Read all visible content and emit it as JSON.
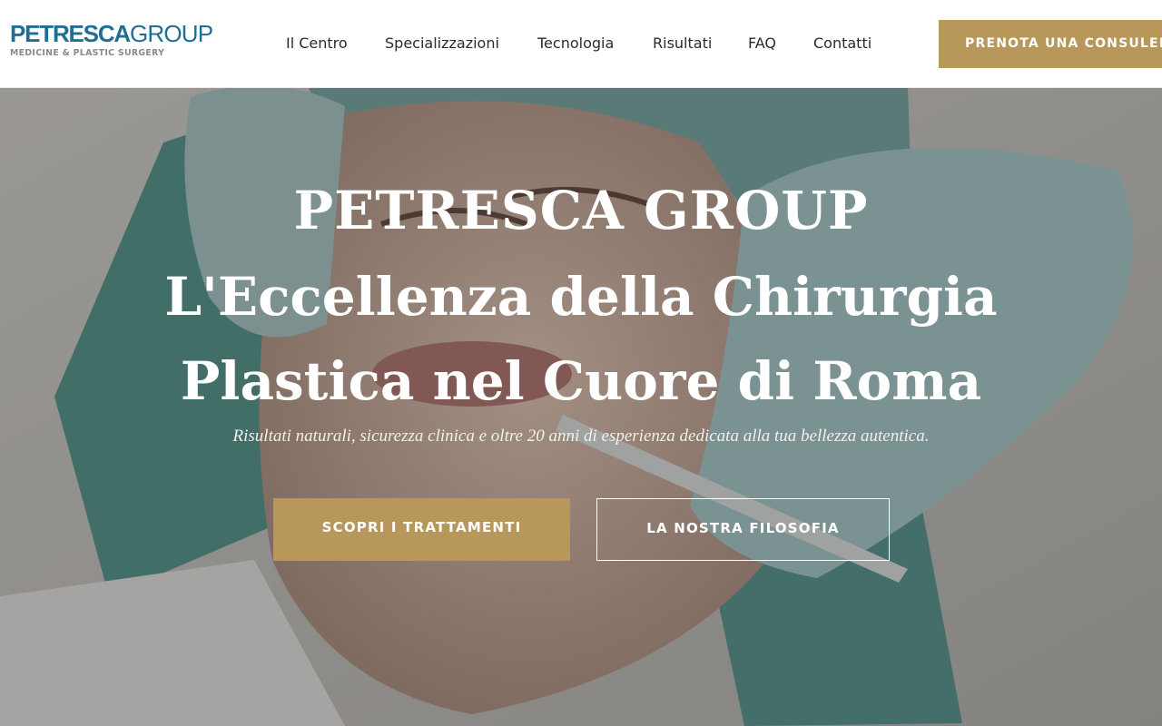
{
  "brand": {
    "name_bold": "PETRESCA",
    "name_light": "GROUP",
    "tagline": "MEDICINE & PLASTIC SURGERY"
  },
  "nav": {
    "items": [
      {
        "label": "Il Centro"
      },
      {
        "label": "Specializzazioni"
      },
      {
        "label": "Tecnologia"
      },
      {
        "label": "Risultati"
      },
      {
        "label": "FAQ"
      },
      {
        "label": "Contatti"
      }
    ],
    "cta": "PRENOTA UNA CONSULENZA"
  },
  "hero": {
    "title_lines": [
      "PETRESCA GROUP",
      "L'Eccellenza della Chirurgia",
      "Plastica nel Cuore di Roma"
    ],
    "subtitle": "Risultati naturali, sicurezza clinica e oltre 20 anni di esperienza dedicata alla tua bellezza autentica.",
    "primary_button": "SCOPRI I TRATTAMENTI",
    "secondary_button": "LA NOSTRA FILOSOFIA"
  },
  "colors": {
    "brand_blue": "#1f6f93",
    "gold": "#b8975a",
    "nav_text": "#2b2b2b"
  }
}
